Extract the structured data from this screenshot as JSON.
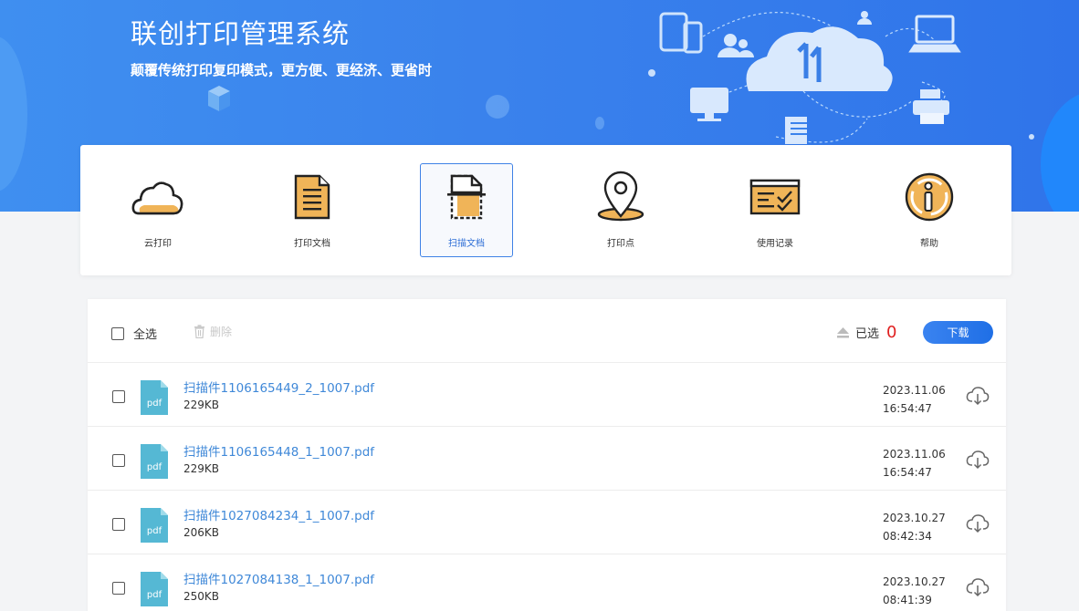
{
  "banner": {
    "title": "联创打印管理系统",
    "subtitle": "颠覆传统打印复印模式，更方便、更经济、更省时"
  },
  "nav": {
    "items": [
      {
        "label": "云打印",
        "icon": "cloud-icon",
        "active": false
      },
      {
        "label": "打印文档",
        "icon": "document-icon",
        "active": false
      },
      {
        "label": "扫描文档",
        "icon": "scan-document-icon",
        "active": true
      },
      {
        "label": "打印点",
        "icon": "location-pin-icon",
        "active": false
      },
      {
        "label": "使用记录",
        "icon": "usage-record-icon",
        "active": false
      },
      {
        "label": "帮助",
        "icon": "info-icon",
        "active": false
      }
    ]
  },
  "toolbar": {
    "select_all": "全选",
    "delete": "删除",
    "selected_label": "已选",
    "selected_count": "0",
    "download": "下载"
  },
  "files": [
    {
      "name": "扫描件1106165449_2_1007.pdf",
      "size": "229KB",
      "date": "2023.11.06",
      "time": "16:54:47",
      "type": "pdf"
    },
    {
      "name": "扫描件1106165448_1_1007.pdf",
      "size": "229KB",
      "date": "2023.11.06",
      "time": "16:54:47",
      "type": "pdf"
    },
    {
      "name": "扫描件1027084234_1_1007.pdf",
      "size": "206KB",
      "date": "2023.10.27",
      "time": "08:42:34",
      "type": "pdf"
    },
    {
      "name": "扫描件1027084138_1_1007.pdf",
      "size": "250KB",
      "date": "2023.10.27",
      "time": "08:41:39",
      "type": "pdf"
    }
  ],
  "colors": {
    "banner": "#3a82ec",
    "accent": "#3f82e6",
    "icon_fill": "#f0b458",
    "file_icon": "#55b8d4",
    "link": "#3f88d8",
    "count": "#e02020"
  }
}
